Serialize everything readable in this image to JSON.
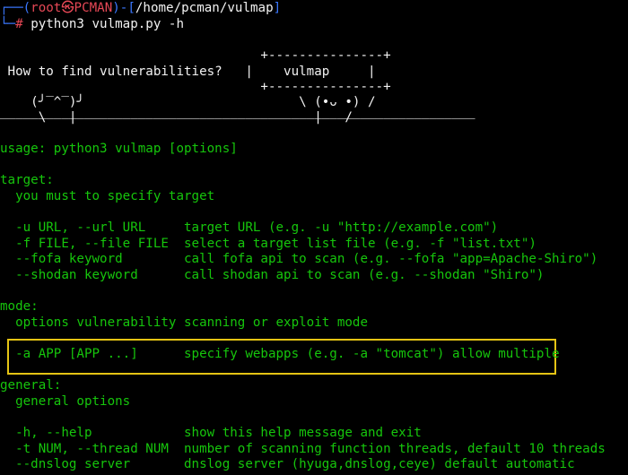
{
  "prompt": {
    "corner_top": "┌──(",
    "user": "root",
    "at": "㉿",
    "host": "PCMAN",
    "sep": ")-[",
    "path": "/home/pcman/vulmap",
    "bracket_close": "]",
    "corner_bottom": "└─",
    "hash": "#",
    "command": "python3 vulmap.py -h"
  },
  "banner": {
    "lines": [
      "                                  +---------------+",
      " How to find vulnerabilities?   |    vulmap     |",
      "                                  +---------------+",
      "    (╯‾^‾)╯                            \\ (•ᴗ •) /",
      "     \\   |                               |   /",
      "‾‾‾‾‾‾‾‾‾‾‾‾‾‾‾‾‾‾‾‾‾‾‾‾‾‾‾‾‾‾‾‾‾‾‾‾‾‾‾‾‾‾‾‾‾‾‾‾‾‾‾‾‾‾‾‾‾‾‾‾‾‾"
    ]
  },
  "help": {
    "usage": "usage: python3 vulmap [options]",
    "target_heading": "target:",
    "target_desc": "  you must to specify target",
    "target_options": [
      "  -u URL, --url URL     target URL (e.g. -u \"http://example.com\")",
      "  -f FILE, --file FILE  select a target list file (e.g. -f \"list.txt\")",
      "  --fofa keyword        call fofa api to scan (e.g. --fofa \"app=Apache-Shiro\")",
      "  --shodan keyword      call shodan api to scan (e.g. --shodan \"Shiro\")"
    ],
    "mode_heading": "mode:",
    "mode_desc": "  options vulnerability scanning or exploit mode",
    "mode_option": "  -a APP [APP ...]      specify webapps (e.g. -a \"tomcat\") allow multiple",
    "general_heading": "general:",
    "general_desc": "  general options",
    "general_options": [
      "  -h, --help            show this help message and exit",
      "  -t NUM, --thread NUM  number of scanning function threads, default 10 threads",
      "  --dnslog server       dnslog server (hyuga,dnslog,ceye) default automatic"
    ]
  },
  "colors": {
    "background": "#000000",
    "text_green": "#16c60c",
    "path_blue": "#3b78ff",
    "host_red": "#e74856",
    "highlight_yellow": "#e5c414"
  }
}
